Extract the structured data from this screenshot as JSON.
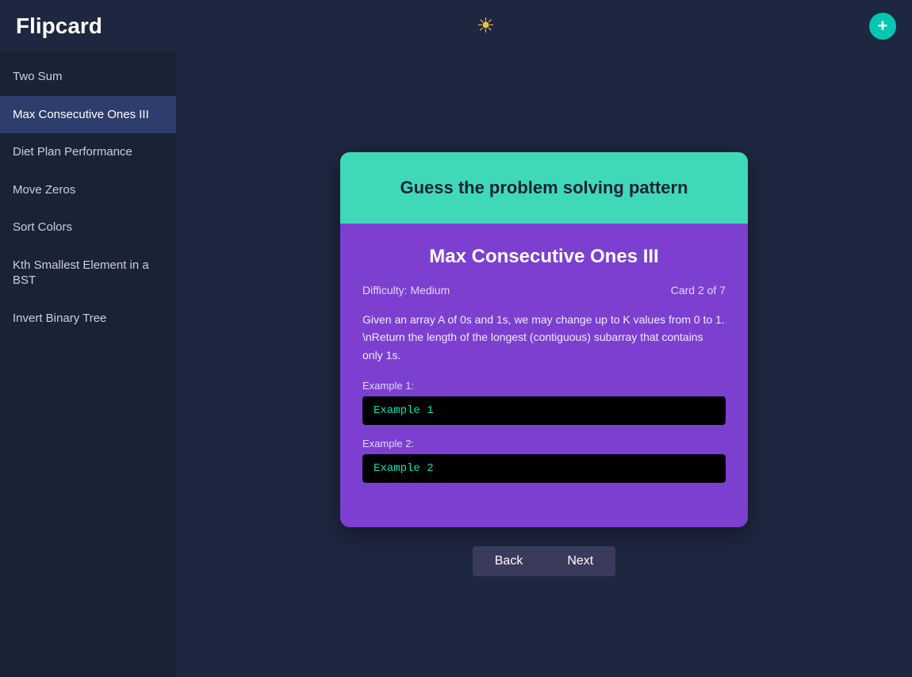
{
  "header": {
    "title": "Flipcard",
    "sun_icon": "☀",
    "add_icon": "+"
  },
  "sidebar": {
    "items": [
      {
        "label": "Two Sum",
        "active": false
      },
      {
        "label": "Max Consecutive Ones III",
        "active": true
      },
      {
        "label": "Diet Plan Performance",
        "active": false
      },
      {
        "label": "Move Zeros",
        "active": false
      },
      {
        "label": "Sort Colors",
        "active": false
      },
      {
        "label": "Kth Smallest Element in a BST",
        "active": false
      },
      {
        "label": "Invert Binary Tree",
        "active": false
      }
    ]
  },
  "flashcard": {
    "top_title": "Guess the problem solving pattern",
    "card_title": "Max Consecutive Ones III",
    "difficulty_label": "Difficulty:",
    "difficulty_value": "Medium",
    "card_number": "Card 2 of 7",
    "description": "Given an array A of 0s and 1s, we may change up to K values from 0 to 1. \\nReturn the length of the longest (contiguous) subarray that contains only 1s.",
    "example1_label": "Example 1:",
    "example1_value": "Example 1",
    "example2_label": "Example 2:",
    "example2_value": "Example 2"
  },
  "nav": {
    "back_label": "Back",
    "next_label": "Next"
  }
}
